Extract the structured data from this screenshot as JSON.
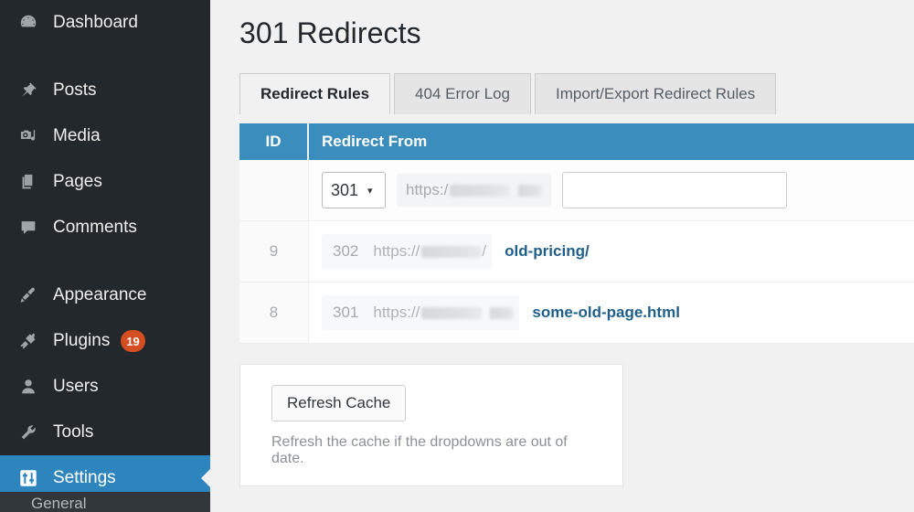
{
  "sidebar": {
    "items": [
      {
        "label": "Dashboard",
        "icon": "dashboard-icon",
        "active": false
      },
      {
        "label": "Posts",
        "icon": "pin-icon",
        "active": false
      },
      {
        "label": "Media",
        "icon": "media-icon",
        "active": false
      },
      {
        "label": "Pages",
        "icon": "pages-icon",
        "active": false
      },
      {
        "label": "Comments",
        "icon": "comments-icon",
        "active": false
      },
      {
        "label": "Appearance",
        "icon": "brush-icon",
        "active": false
      },
      {
        "label": "Plugins",
        "icon": "plug-icon",
        "badge": "19",
        "active": false
      },
      {
        "label": "Users",
        "icon": "user-icon",
        "active": false
      },
      {
        "label": "Tools",
        "icon": "wrench-icon",
        "active": false
      },
      {
        "label": "Settings",
        "icon": "settings-icon",
        "active": true
      }
    ],
    "submenu_peek": "General"
  },
  "header": {
    "title": "301 Redirects"
  },
  "tabs": [
    {
      "label": "Redirect Rules",
      "active": true
    },
    {
      "label": "404 Error Log",
      "active": false
    },
    {
      "label": "Import/Export Redirect Rules",
      "active": false
    }
  ],
  "table": {
    "columns": {
      "id": "ID",
      "redirect_from": "Redirect From"
    },
    "add_row": {
      "status_code": "301",
      "caret": "▾",
      "prefix": "https:/",
      "url_value": "",
      "url_placeholder": ""
    },
    "rows": [
      {
        "id": "9",
        "status_code": "302",
        "prefix": "https://",
        "separator": "/",
        "path": "old-pricing/"
      },
      {
        "id": "8",
        "status_code": "301",
        "prefix": "https://",
        "separator": "",
        "path": "some-old-page.html"
      }
    ]
  },
  "cache_panel": {
    "button_label": "Refresh Cache",
    "help_text": "Refresh the cache if the dropdowns are out of date."
  },
  "colors": {
    "sidebar_bg": "#23282d",
    "sidebar_active": "#2e85bd",
    "table_header": "#3b8dbd",
    "link": "#1f5f8b",
    "badge": "#d54e21",
    "page_bg": "#f1f1f1"
  }
}
